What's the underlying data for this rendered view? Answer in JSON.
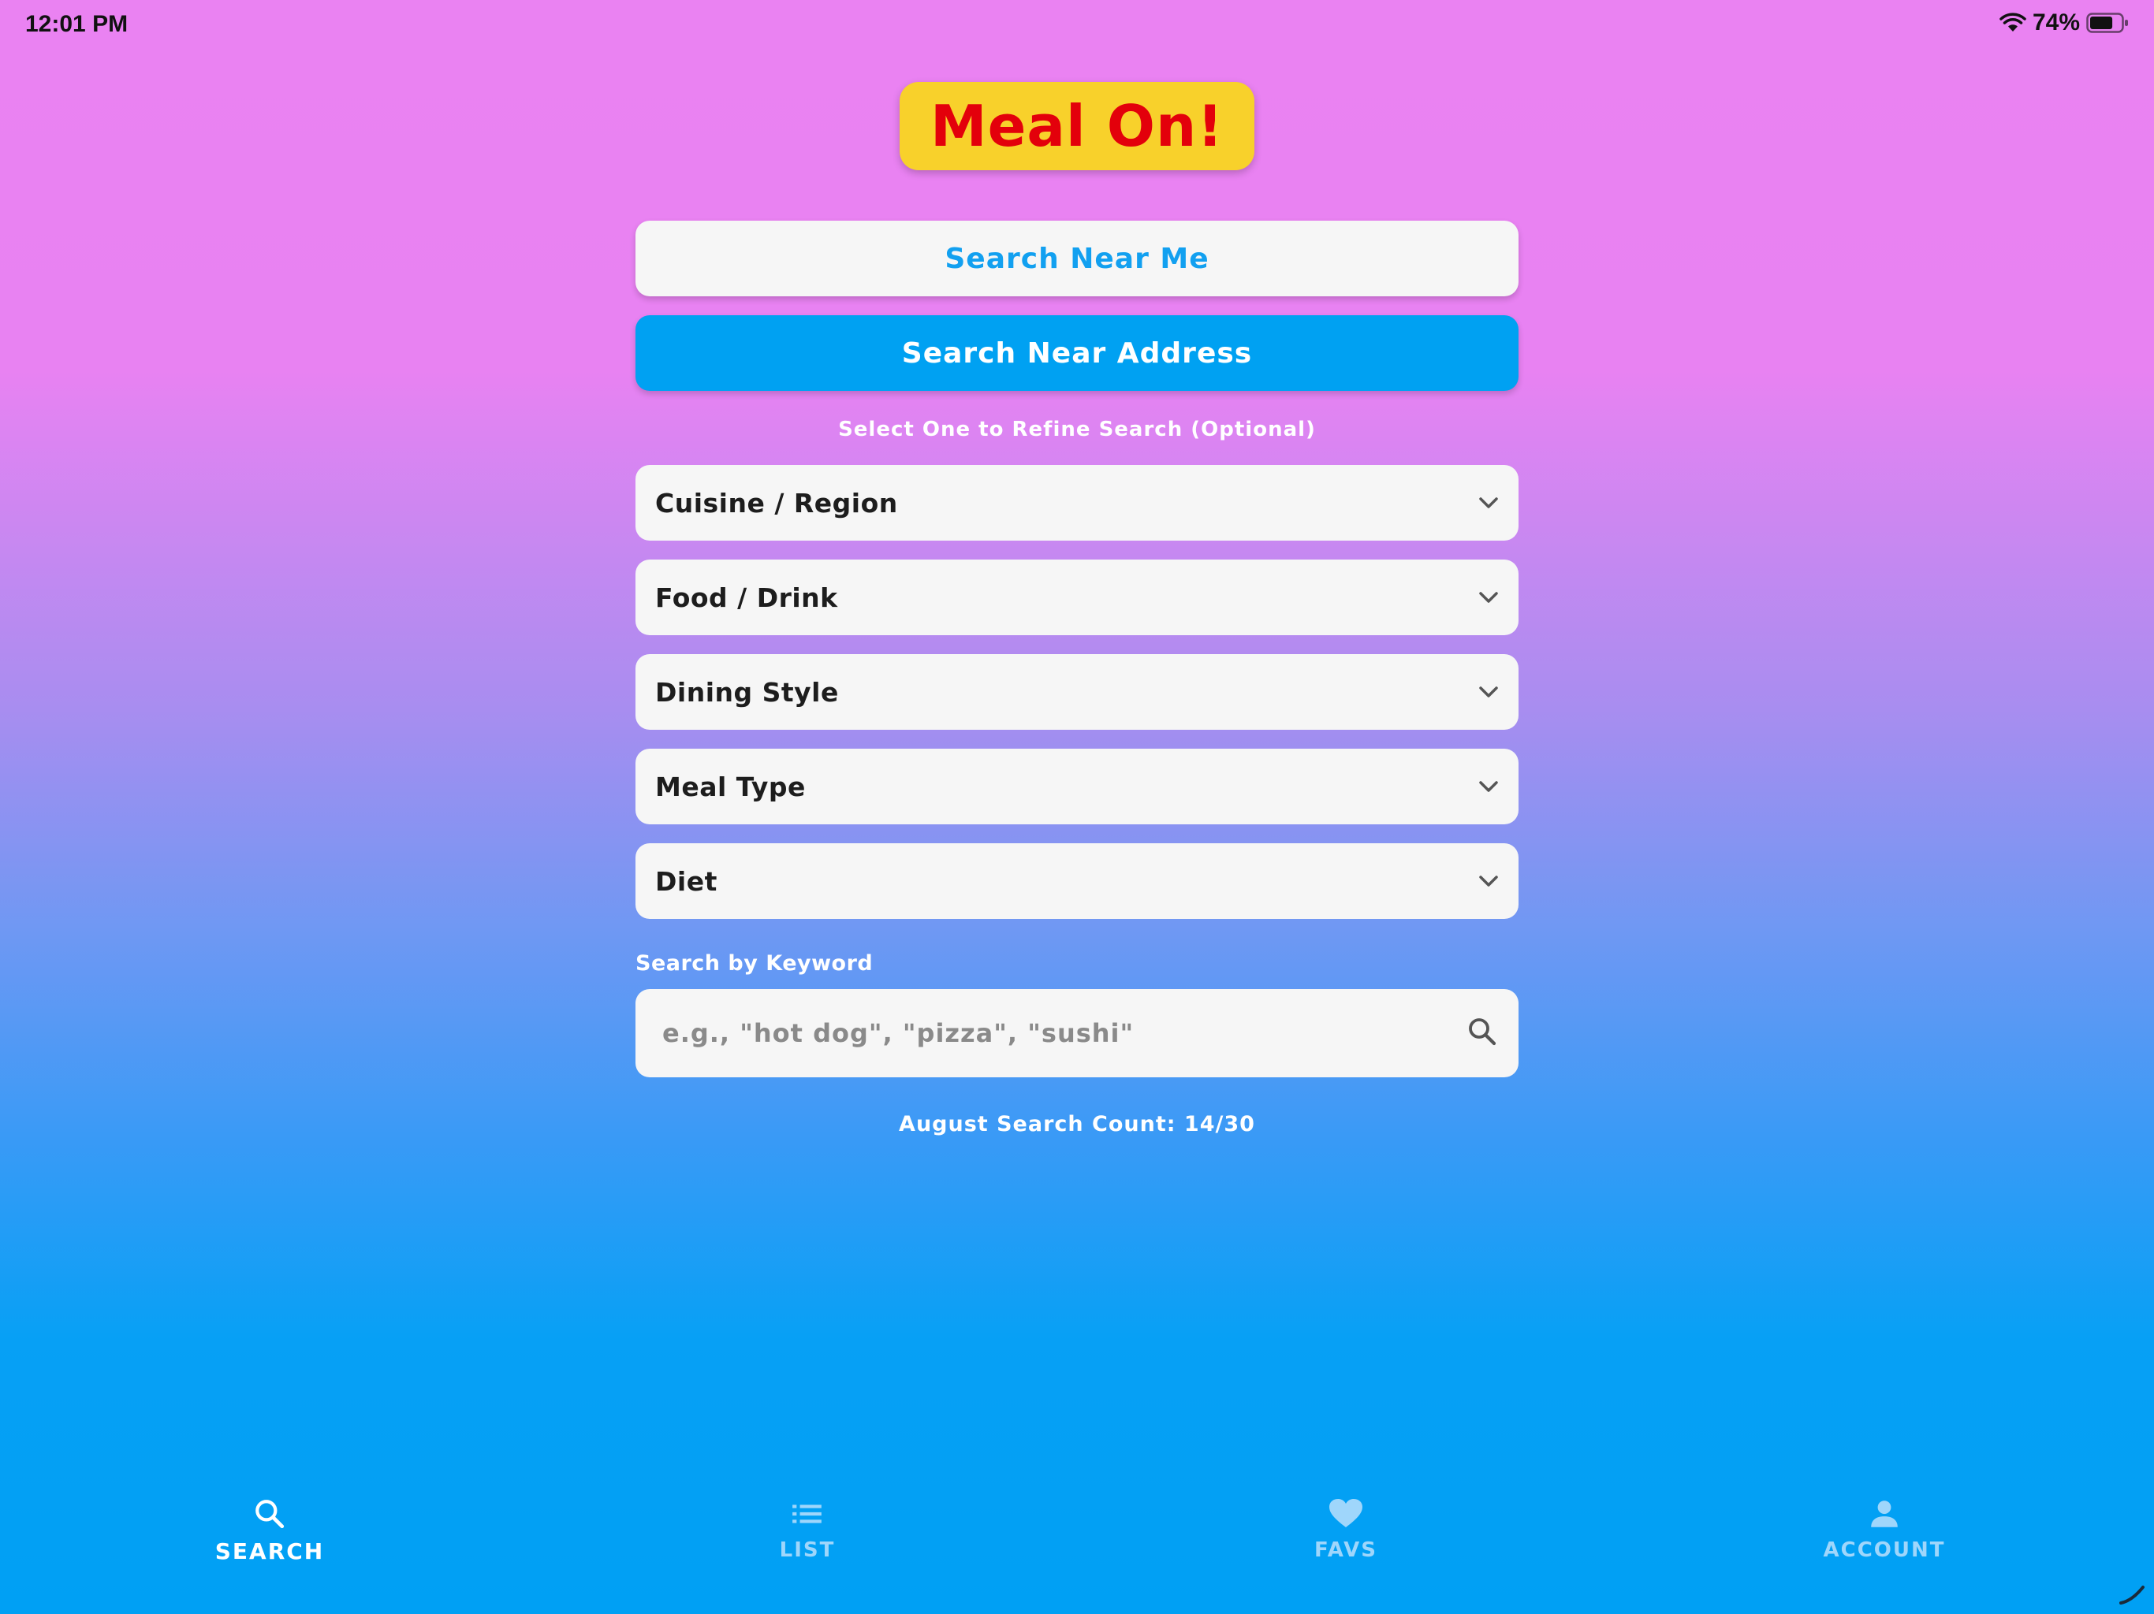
{
  "status_bar": {
    "time": "12:01 PM",
    "battery_percent": "74%",
    "battery_level": 0.74
  },
  "app": {
    "logo_text": "Meal On!"
  },
  "buttons": {
    "search_near_me": "Search Near Me",
    "search_near_address": "Search Near Address"
  },
  "refine": {
    "label": "Select One to Refine Search (Optional)",
    "dropdowns": [
      {
        "label": "Cuisine / Region",
        "icon": "chevron-down-icon"
      },
      {
        "label": "Food / Drink",
        "icon": "chevron-down-icon"
      },
      {
        "label": "Dining Style",
        "icon": "chevron-down-icon"
      },
      {
        "label": "Meal Type",
        "icon": "chevron-down-icon"
      },
      {
        "label": "Diet",
        "icon": "chevron-down-icon"
      }
    ]
  },
  "keyword": {
    "label": "Search by Keyword",
    "value": "",
    "placeholder": "e.g., \"hot dog\", \"pizza\", \"sushi\"",
    "icon": "search-icon"
  },
  "search_count": {
    "text": "August Search Count: 14/30"
  },
  "tabs": [
    {
      "label": "SEARCH",
      "icon": "search-icon",
      "active": true
    },
    {
      "label": "LIST",
      "icon": "list-icon",
      "active": false
    },
    {
      "label": "FAVS",
      "icon": "heart-icon",
      "active": false
    },
    {
      "label": "ACCOUNT",
      "icon": "person-icon",
      "active": false
    }
  ],
  "colors": {
    "gradient_top": "#ea82f2",
    "gradient_bottom": "#00a0f4",
    "logo_bg": "#f8d12b",
    "logo_text": "#e3000b",
    "primary_blue": "#00a1f2",
    "light_button_text": "#12a0f0",
    "tab_inactive": "#9fd6fb"
  }
}
